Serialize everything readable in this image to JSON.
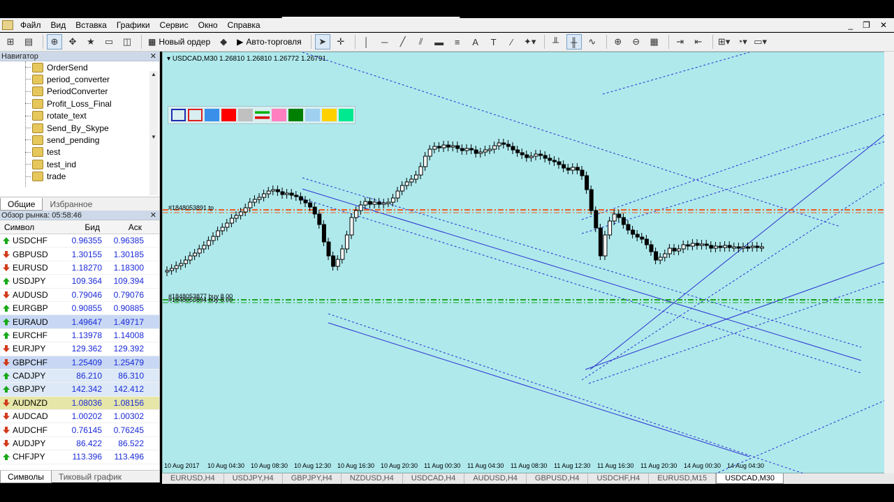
{
  "menu": {
    "items": [
      "Файл",
      "Вид",
      "Вставка",
      "Графики",
      "Сервис",
      "Окно",
      "Справка"
    ]
  },
  "toolbar": {
    "new_order": "Новый ордер",
    "autotrading": "Авто-торговля",
    "text_tool": "A"
  },
  "navigator": {
    "title": "Навигатор",
    "items": [
      "OrderSend",
      "period_converter",
      "PeriodConverter",
      "Profit_Loss_Final",
      "rotate_text",
      "Send_By_Skype",
      "send_pending",
      "test",
      "test_ind",
      "trade"
    ],
    "tabs": [
      "Общие",
      "Избранное"
    ]
  },
  "market_watch": {
    "title": "Обзор рынка: 05:58:46",
    "headers": [
      "Символ",
      "Бид",
      "Аск"
    ],
    "rows": [
      {
        "symbol": "USDCHF",
        "bid": "0.96355",
        "ask": "0.96385",
        "dir": "up"
      },
      {
        "symbol": "GBPUSD",
        "bid": "1.30155",
        "ask": "1.30185",
        "dir": "down"
      },
      {
        "symbol": "EURUSD",
        "bid": "1.18270",
        "ask": "1.18300",
        "dir": "down"
      },
      {
        "symbol": "USDJPY",
        "bid": "109.364",
        "ask": "109.394",
        "dir": "up"
      },
      {
        "symbol": "AUDUSD",
        "bid": "0.79046",
        "ask": "0.79076",
        "dir": "down"
      },
      {
        "symbol": "EURGBP",
        "bid": "0.90855",
        "ask": "0.90885",
        "dir": "up"
      },
      {
        "symbol": "EURAUD",
        "bid": "1.49647",
        "ask": "1.49717",
        "dir": "up"
      },
      {
        "symbol": "EURCHF",
        "bid": "1.13978",
        "ask": "1.14008",
        "dir": "up"
      },
      {
        "symbol": "EURJPY",
        "bid": "129.362",
        "ask": "129.392",
        "dir": "down"
      },
      {
        "symbol": "GBPCHF",
        "bid": "1.25409",
        "ask": "1.25479",
        "dir": "down"
      },
      {
        "symbol": "CADJPY",
        "bid": "86.210",
        "ask": "86.310",
        "dir": "up"
      },
      {
        "symbol": "GBPJPY",
        "bid": "142.342",
        "ask": "142.412",
        "dir": "up"
      },
      {
        "symbol": "AUDNZD",
        "bid": "1.08036",
        "ask": "1.08156",
        "dir": "down"
      },
      {
        "symbol": "AUDCAD",
        "bid": "1.00202",
        "ask": "1.00302",
        "dir": "down"
      },
      {
        "symbol": "AUDCHF",
        "bid": "0.76145",
        "ask": "0.76245",
        "dir": "down"
      },
      {
        "symbol": "AUDJPY",
        "bid": "86.422",
        "ask": "86.522",
        "dir": "down"
      },
      {
        "symbol": "CHFJPY",
        "bid": "113.396",
        "ask": "113.496",
        "dir": "up"
      }
    ],
    "tabs": [
      "Символы",
      "Тиковый график"
    ]
  },
  "chart": {
    "header": "USDCAD,M30  1.26810 1.26810 1.26772 1.26791",
    "line_label_top": "#1848053891 tp",
    "line_label_mid1": "#1848053877 buy 8.00",
    "line_label_mid2": "#1848053894 buy 8.00",
    "time_labels": [
      "10 Aug 2017",
      "10 Aug 04:30",
      "10 Aug 08:30",
      "10 Aug 12:30",
      "10 Aug 16:30",
      "10 Aug 20:30",
      "11 Aug 00:30",
      "11 Aug 04:30",
      "11 Aug 08:30",
      "11 Aug 12:30",
      "11 Aug 16:30",
      "11 Aug 20:30",
      "14 Aug 00:30",
      "14 Aug 04:30"
    ],
    "bg_color": "#afe9ec",
    "tp_line_color": "#f05a1e",
    "buy_line_color": "#1aa21a",
    "channel_color": "#2a30d0"
  },
  "chart_tabs": [
    "EURUSD,H4",
    "USDJPY,H4",
    "GBPJPY,H4",
    "NZDUSD,H4",
    "USDCAD,H4",
    "AUDUSD,H4",
    "GBPUSD,H4",
    "USDCHF,H4",
    "EURUSD,M15",
    "USDCAD,M30"
  ],
  "palette": [
    "#ffffff",
    "#ffffff",
    "#3a8fe8",
    "#ff0000",
    "#c0c0c0",
    "#ffffff",
    "#ff7fbf",
    "#008000",
    "#9fd0f0",
    "#ffd000",
    "#00e890"
  ]
}
